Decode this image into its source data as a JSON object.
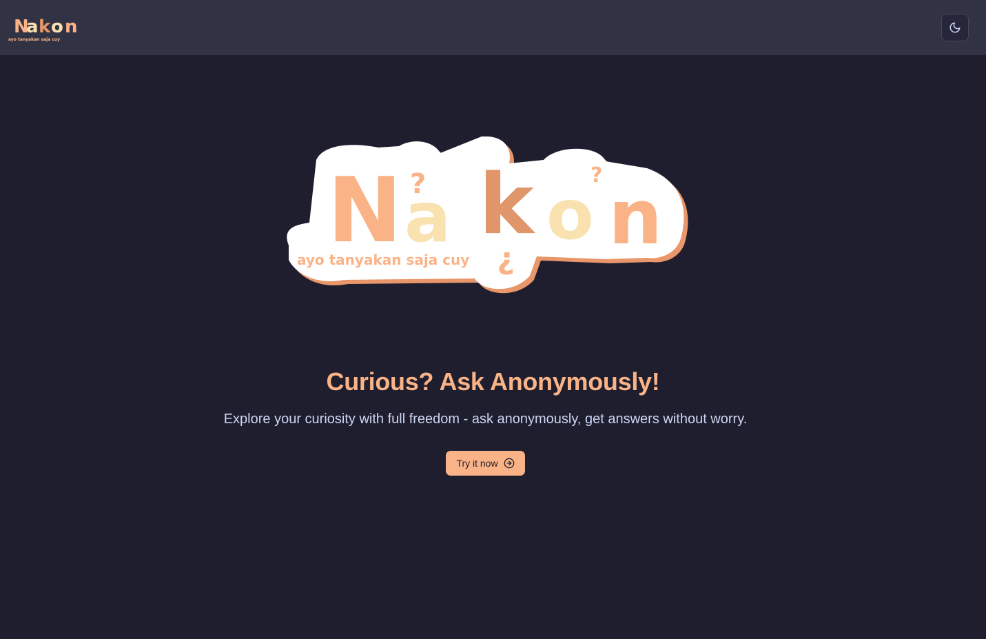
{
  "navbar": {
    "logo_text": "N?ak?on",
    "logo_tagline": "ayo tanyakan saja cuy",
    "theme_icon": "moon-icon"
  },
  "hero": {
    "logo_text": "N?ak?on",
    "logo_tagline": "ayo tanyakan saja cuy",
    "headline": "Curious? Ask Anonymously!",
    "subtitle": "Explore your curiosity with full freedom - ask anonymously, get answers without worry.",
    "cta_label": "Try it now",
    "cta_icon": "arrow-right-circle-icon"
  },
  "colors": {
    "background": "#1e1e2e",
    "navbar": "#313244",
    "accent": "#fab387",
    "text": "#cdd6f4"
  }
}
